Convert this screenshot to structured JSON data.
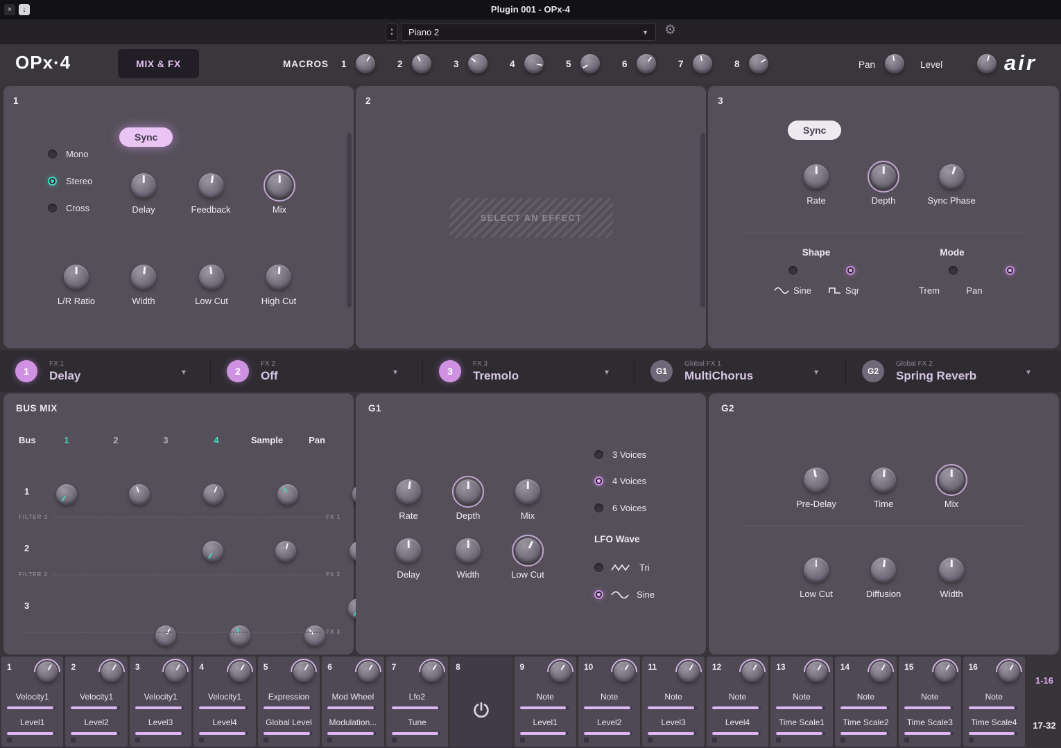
{
  "colors": {
    "accent_purple": "#d9a7ec",
    "accent_teal": "#43d6bd",
    "value_text": "#d5c7e3",
    "panel_bg": "#544f59"
  },
  "icons": {
    "close": "×",
    "dock": "↓",
    "gear": "⚙",
    "caret_down": "▼",
    "stepper_up": "▲",
    "stepper_down": "▼",
    "chevron_down": "▾"
  },
  "titlebar": {
    "title": "Plugin 001 - OPx-4"
  },
  "preset_bar": {
    "preset": "Piano 2"
  },
  "header": {
    "logo": "OPx·4",
    "tab_label": "MIX & FX",
    "macros_label": "MACROS",
    "macros": [
      {
        "number": "1"
      },
      {
        "number": "2"
      },
      {
        "number": "3"
      },
      {
        "number": "4"
      },
      {
        "number": "5"
      },
      {
        "number": "6"
      },
      {
        "number": "7"
      },
      {
        "number": "8"
      }
    ],
    "pan_label": "Pan",
    "level_label": "Level",
    "brand": "air"
  },
  "fx1": {
    "number": "1",
    "sync_label": "Sync",
    "modes": [
      {
        "label": "Mono"
      },
      {
        "label": "Stereo"
      },
      {
        "label": "Cross"
      }
    ],
    "selected_mode": "Stereo",
    "knobs_top": [
      {
        "label": "Delay"
      },
      {
        "label": "Feedback"
      },
      {
        "label": "Mix"
      }
    ],
    "knobs_bottom": [
      {
        "label": "L/R Ratio"
      },
      {
        "label": "Width"
      },
      {
        "label": "Low Cut"
      },
      {
        "label": "High Cut"
      }
    ]
  },
  "fx2": {
    "number": "2",
    "placeholder": "SELECT AN EFFECT"
  },
  "fx3": {
    "number": "3",
    "sync_label": "Sync",
    "knobs": [
      {
        "label": "Rate"
      },
      {
        "label": "Depth"
      },
      {
        "label": "Sync Phase"
      }
    ],
    "shape": {
      "title": "Shape",
      "options": [
        {
          "label": "Sine"
        },
        {
          "label": "Sqr"
        }
      ],
      "selected": "Sqr"
    },
    "mode": {
      "title": "Mode",
      "options": [
        {
          "label": "Trem"
        },
        {
          "label": "Pan"
        }
      ],
      "selected": "Pan"
    }
  },
  "fx_strip": {
    "items": [
      {
        "badge": "1",
        "label": "FX 1",
        "value": "Delay"
      },
      {
        "badge": "2",
        "label": "FX 2",
        "value": "Off"
      },
      {
        "badge": "3",
        "label": "FX 3",
        "value": "Tremolo"
      },
      {
        "badge": "G1",
        "label": "Global FX 1",
        "value": "MultiChorus"
      },
      {
        "badge": "G2",
        "label": "Global FX 2",
        "value": "Spring Reverb"
      }
    ]
  },
  "bus_mix": {
    "title": "BUS MIX",
    "bus_label": "Bus",
    "columns": [
      {
        "label": "1"
      },
      {
        "label": "2"
      },
      {
        "label": "3"
      },
      {
        "label": "4"
      }
    ],
    "sample_label": "Sample",
    "pan_label": "Pan",
    "rows": [
      {
        "number": "1",
        "left_label": "FILTER 1",
        "right_label": "FX 1"
      },
      {
        "number": "2",
        "left_label": "FILTER 2",
        "right_label": "FX 2"
      },
      {
        "number": "3",
        "left_label": "",
        "right_label": "FX 3"
      }
    ]
  },
  "g1": {
    "title": "G1",
    "knobs_row1": [
      {
        "label": "Rate"
      },
      {
        "label": "Depth"
      },
      {
        "label": "Mix"
      }
    ],
    "knobs_row2": [
      {
        "label": "Delay"
      },
      {
        "label": "Width"
      },
      {
        "label": "Low Cut"
      }
    ],
    "voices": [
      {
        "label": "3 Voices"
      },
      {
        "label": "4 Voices"
      },
      {
        "label": "6 Voices"
      }
    ],
    "selected_voice": "4 Voices",
    "lfo_title": "LFO Wave",
    "lfo_options": [
      {
        "label": "Tri"
      },
      {
        "label": "Sine"
      }
    ],
    "selected_lfo": "Sine"
  },
  "g2": {
    "title": "G2",
    "knobs_row1": [
      {
        "label": "Pre-Delay"
      },
      {
        "label": "Time"
      },
      {
        "label": "Mix"
      }
    ],
    "knobs_row2": [
      {
        "label": "Low Cut"
      },
      {
        "label": "Diffusion"
      },
      {
        "label": "Width"
      }
    ]
  },
  "macro_strip": {
    "page_a": "1-16",
    "page_b": "17-32",
    "cells": [
      {
        "n": "1",
        "line1": "Velocity1",
        "line2": "Level1",
        "bar1": 95,
        "bar2": 95
      },
      {
        "n": "2",
        "line1": "Velocity1",
        "line2": "Level2",
        "bar1": 95,
        "bar2": 95
      },
      {
        "n": "3",
        "line1": "Velocity1",
        "line2": "Level3",
        "bar1": 95,
        "bar2": 95
      },
      {
        "n": "4",
        "line1": "Velocity1",
        "line2": "Level4",
        "bar1": 95,
        "bar2": 95
      },
      {
        "n": "5",
        "line1": "Expression",
        "line2": "Global Level",
        "bar1": 95,
        "bar2": 95
      },
      {
        "n": "6",
        "line1": "Mod Wheel",
        "line2": "Modulation...",
        "bar1": 95,
        "bar2": 95
      },
      {
        "n": "7",
        "line1": "Lfo2",
        "line2": "Tune",
        "bar1": 95,
        "bar2": 95
      },
      {
        "n": "8",
        "power": true
      },
      {
        "n": "9",
        "line1": "Note",
        "line2": "Level1",
        "bar1": 95,
        "bar2": 95
      },
      {
        "n": "10",
        "line1": "Note",
        "line2": "Level2",
        "bar1": 95,
        "bar2": 95
      },
      {
        "n": "11",
        "line1": "Note",
        "line2": "Level3",
        "bar1": 95,
        "bar2": 95
      },
      {
        "n": "12",
        "line1": "Note",
        "line2": "Level4",
        "bar1": 95,
        "bar2": 95
      },
      {
        "n": "13",
        "line1": "Note",
        "line2": "Time Scale1",
        "bar1": 95,
        "bar2": 95
      },
      {
        "n": "14",
        "line1": "Note",
        "line2": "Time Scale2",
        "bar1": 95,
        "bar2": 95
      },
      {
        "n": "15",
        "line1": "Note",
        "line2": "Time Scale3",
        "bar1": 95,
        "bar2": 95
      },
      {
        "n": "16",
        "line1": "Note",
        "line2": "Time Scale4",
        "bar1": 95,
        "bar2": 95
      }
    ]
  }
}
